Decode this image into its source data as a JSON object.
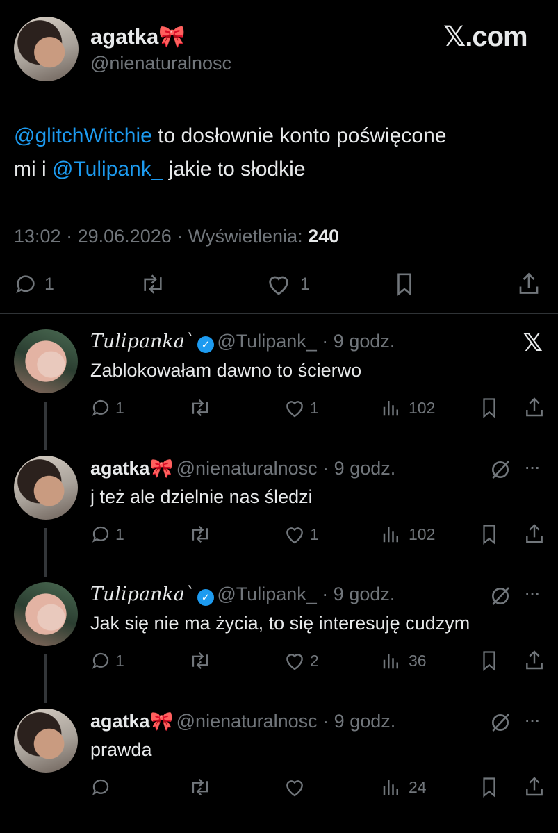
{
  "main_tweet": {
    "display_name": "agatka",
    "name_emoji": "🎀",
    "handle": "@nienaturalnosc",
    "brand": "𝕏.com",
    "text_parts": {
      "mention1": "@glitchWitchie",
      "part1": " to dosłownie konto poświęcone",
      "line2_prefix": "mi i ",
      "mention2": "@Tulipank_",
      "part2": " jakie to słodkie"
    },
    "time": "13:02",
    "date": "29.06.2026",
    "views_label": "Wyświetlenia:",
    "views_count": "240",
    "separator": "·",
    "replies": "1",
    "likes": "1"
  },
  "replies": [
    {
      "display_name": "Tulipanka`",
      "verified": true,
      "handle": "@Tulipank_",
      "time": "9 godz.",
      "text": "Zablokowałam dawno to ścierwo",
      "replies": "1",
      "likes": "1",
      "views": "102",
      "corner_icon": "x-logo"
    },
    {
      "display_name": "agatka",
      "name_emoji": "🎀",
      "handle": "@nienaturalnosc",
      "time": "9 godz.",
      "text": "j też ale dzielnie nas śledzi",
      "replies": "1",
      "likes": "1",
      "views": "102",
      "corner_icon": "grok-icon"
    },
    {
      "display_name": "Tulipanka`",
      "verified": true,
      "handle": "@Tulipank_",
      "time": "9 godz.",
      "text": "Jak się nie ma życia, to się interesuję cudzym",
      "replies": "1",
      "likes": "2",
      "views": "36",
      "corner_icon": "grok-icon"
    },
    {
      "display_name": "agatka",
      "name_emoji": "🎀",
      "handle": "@nienaturalnosc",
      "time": "9 godz.",
      "text": "prawda",
      "replies": "",
      "likes": "",
      "views": "24",
      "corner_icon": "grok-icon"
    }
  ],
  "more_label": "···",
  "colors": {
    "background": "#000000",
    "text": "#e7e9ea",
    "muted": "#71767b",
    "accent": "#1d9bf0",
    "divider": "#2f3336"
  }
}
